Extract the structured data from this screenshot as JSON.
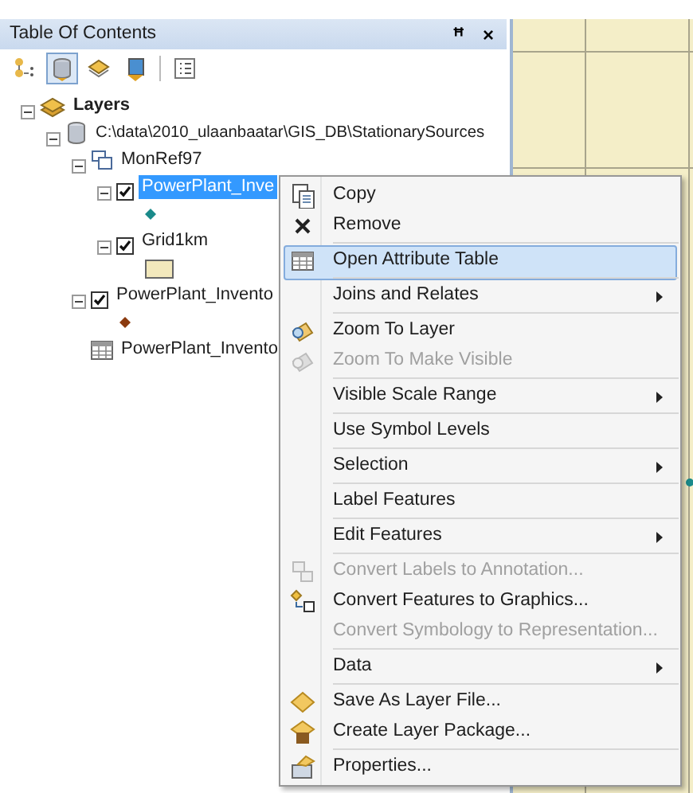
{
  "panel": {
    "title": "Table Of Contents",
    "pin": "ꟸ",
    "close": "×",
    "toolbar": [
      {
        "selected": false
      },
      {
        "selected": true
      },
      {
        "selected": false
      },
      {
        "selected": false
      },
      {
        "selected": false
      }
    ]
  },
  "tree": [
    {
      "label": "Layers",
      "kind": "frame",
      "expanded": true,
      "children": [
        {
          "label": "C:\\data\\2010_ulaanbaatar\\GIS_DB\\StationarySources",
          "kind": "workspace",
          "expanded": true,
          "children": [
            {
              "label": "MonRef97",
              "kind": "group",
              "expanded": true,
              "children": [
                {
                  "label": "PowerPlant_Inve",
                  "kind": "layer",
                  "expanded": true,
                  "checked": true,
                  "selected": true,
                  "legend": {
                    "kind": "point",
                    "color": "#1a8a8a"
                  }
                },
                {
                  "label": "Grid1km",
                  "kind": "layer",
                  "expanded": true,
                  "checked": true,
                  "selected": false,
                  "legend": {
                    "kind": "fill",
                    "color": "#f2e8bc"
                  }
                }
              ]
            },
            {
              "label": "PowerPlant_Invento",
              "kind": "layer",
              "expanded": true,
              "checked": true,
              "selected": false,
              "legend": {
                "kind": "point",
                "color": "#8b3a0f"
              }
            },
            {
              "label": "PowerPlant_Invento",
              "kind": "table"
            }
          ]
        }
      ]
    }
  ],
  "menu": [
    {
      "label": "Copy",
      "disabled": false,
      "selected": false,
      "submenu": false,
      "separator_after": false
    },
    {
      "label": "Remove",
      "disabled": false,
      "selected": false,
      "submenu": false,
      "separator_after": true
    },
    {
      "label": "Open Attribute Table",
      "disabled": false,
      "selected": true,
      "submenu": false,
      "separator_after": true
    },
    {
      "label": "Joins and Relates",
      "disabled": false,
      "selected": false,
      "submenu": true,
      "separator_after": true
    },
    {
      "label": "Zoom To Layer",
      "disabled": false,
      "selected": false,
      "submenu": false,
      "separator_after": false
    },
    {
      "label": "Zoom To Make Visible",
      "disabled": true,
      "selected": false,
      "submenu": false,
      "separator_after": true
    },
    {
      "label": "Visible Scale Range",
      "disabled": false,
      "selected": false,
      "submenu": true,
      "separator_after": true
    },
    {
      "label": "Use Symbol Levels",
      "disabled": false,
      "selected": false,
      "submenu": false,
      "separator_after": true
    },
    {
      "label": "Selection",
      "disabled": false,
      "selected": false,
      "submenu": true,
      "separator_after": true
    },
    {
      "label": "Label Features",
      "disabled": false,
      "selected": false,
      "submenu": false,
      "separator_after": true
    },
    {
      "label": "Edit Features",
      "disabled": false,
      "selected": false,
      "submenu": true,
      "separator_after": true
    },
    {
      "label": "Convert Labels to Annotation...",
      "disabled": true,
      "selected": false,
      "submenu": false,
      "separator_after": false
    },
    {
      "label": "Convert Features to Graphics...",
      "disabled": false,
      "selected": false,
      "submenu": false,
      "separator_after": false
    },
    {
      "label": "Convert Symbology to Representation...",
      "disabled": true,
      "selected": false,
      "submenu": false,
      "separator_after": true
    },
    {
      "label": "Data",
      "disabled": false,
      "selected": false,
      "submenu": true,
      "separator_after": true
    },
    {
      "label": "Save As Layer File...",
      "disabled": false,
      "selected": false,
      "submenu": false,
      "separator_after": false
    },
    {
      "label": "Create Layer Package...",
      "disabled": false,
      "selected": false,
      "submenu": false,
      "separator_after": true
    },
    {
      "label": "Properties...",
      "disabled": false,
      "selected": false,
      "submenu": false,
      "separator_after": false
    }
  ]
}
